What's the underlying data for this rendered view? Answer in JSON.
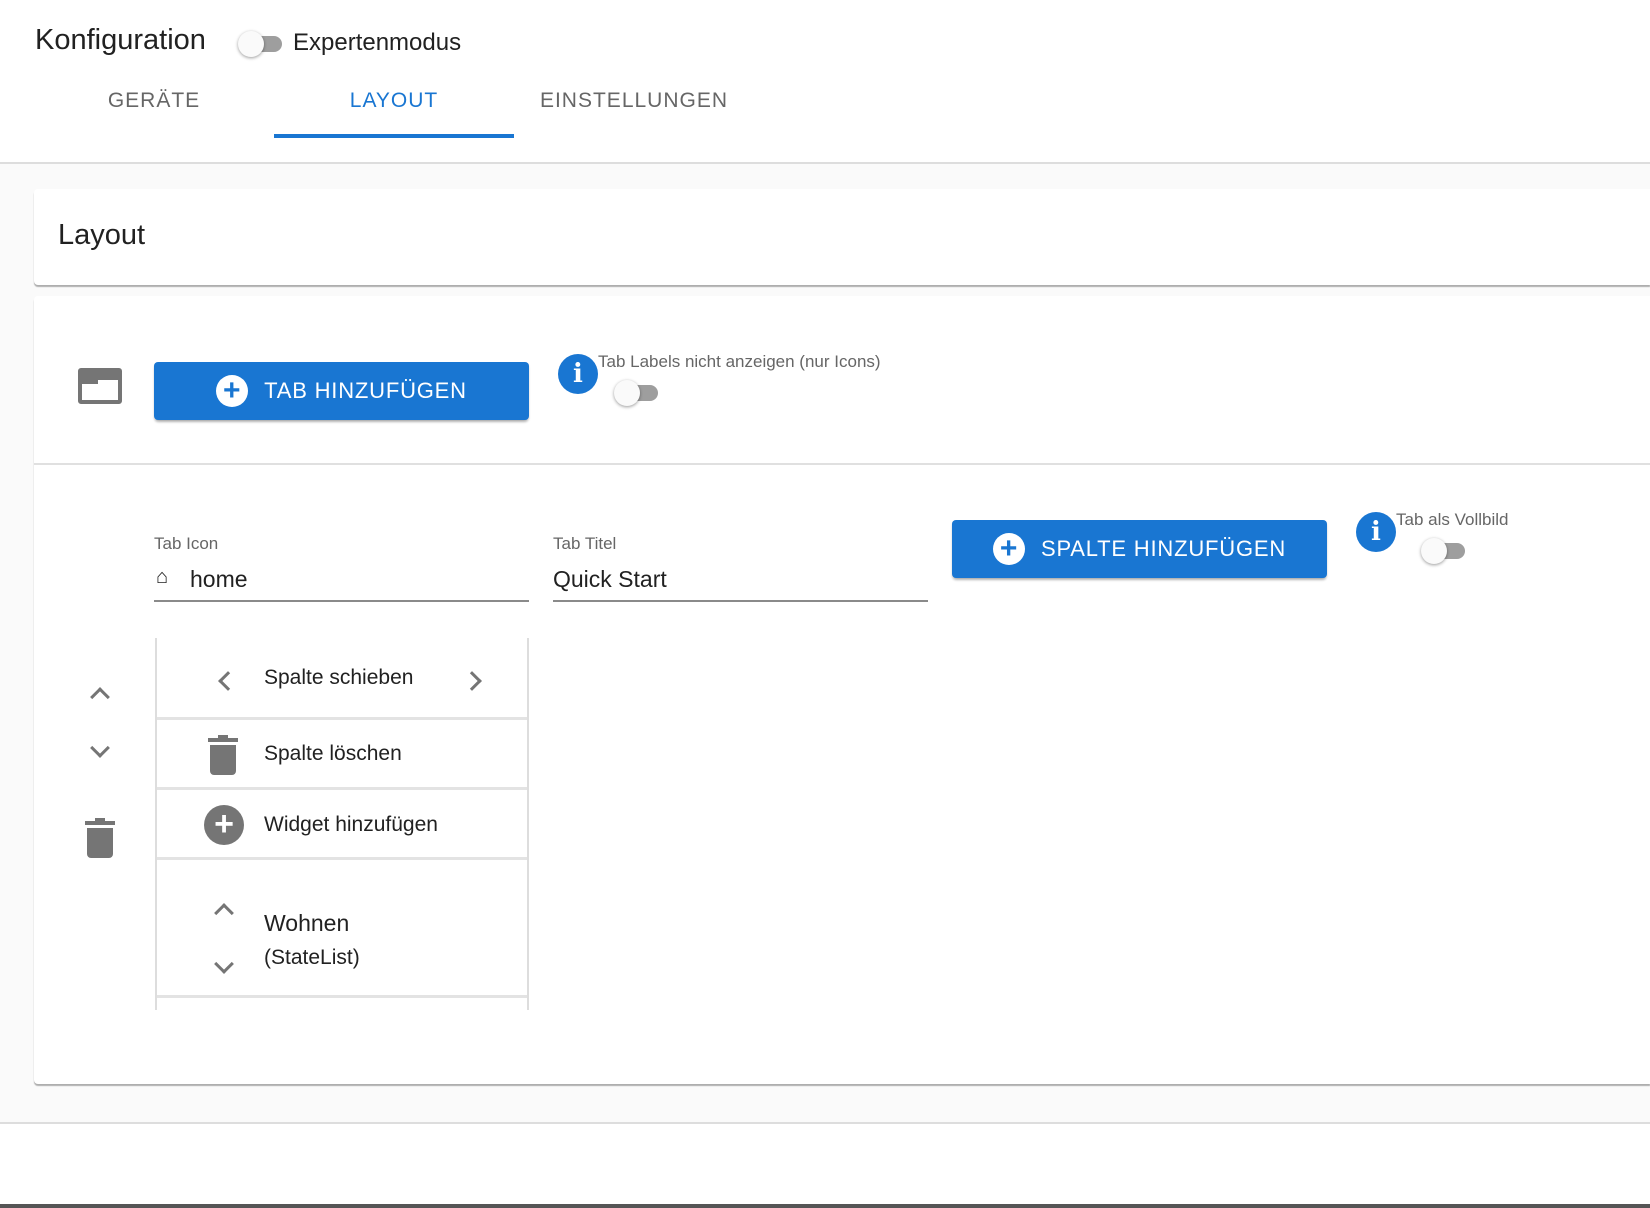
{
  "header": {
    "title": "Konfiguration",
    "expert_mode_label": "Expertenmodus",
    "expert_mode_on": false
  },
  "tabs": [
    {
      "label": "GERÄTE",
      "active": false
    },
    {
      "label": "LAYOUT",
      "active": true
    },
    {
      "label": "EINSTELLUNGEN",
      "active": false
    }
  ],
  "layout_card": {
    "title": "Layout"
  },
  "tab_controls": {
    "add_tab_label": "TAB HINZUFÜGEN",
    "hide_labels_label": "Tab Labels nicht anzeigen (nur Icons)",
    "hide_labels_on": false
  },
  "tab_editor": {
    "icon_label": "Tab Icon",
    "icon_value": "home",
    "title_label": "Tab Titel",
    "title_value": "Quick Start",
    "add_column_label": "SPALTE HINZUFÜGEN",
    "fullscreen_label": "Tab als Vollbild",
    "fullscreen_on": false
  },
  "column": {
    "move_label": "Spalte schieben",
    "delete_label": "Spalte löschen",
    "add_widget_label": "Widget hinzufügen",
    "widgets": [
      {
        "name": "Wohnen",
        "type": "(StateList)"
      }
    ]
  },
  "colors": {
    "accent": "#1976d2",
    "icon_gray": "#757575"
  }
}
